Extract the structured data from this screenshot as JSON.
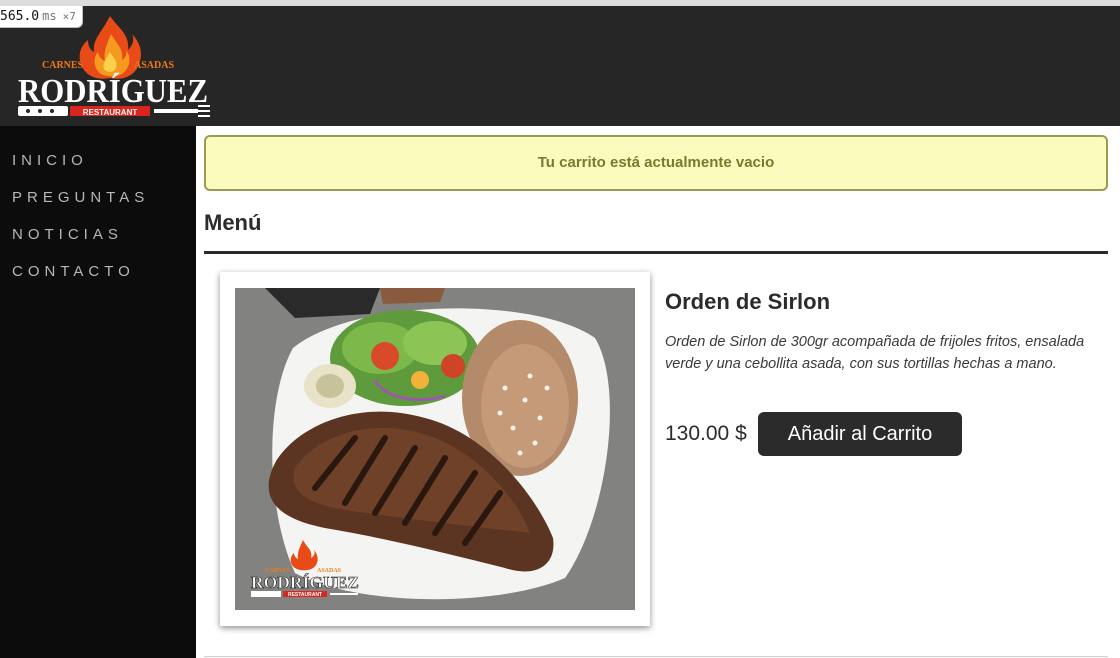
{
  "debug_overlay": {
    "time_value": "565.0",
    "time_unit": "ms",
    "multiplier": "×7"
  },
  "brand": {
    "line_left": "CARNES",
    "line_right": "ASADAS",
    "name": "RODRÍGUEZ",
    "sub": "RESTAURANT",
    "colors": {
      "orange": "#f07a1a",
      "red": "#d9251c",
      "white": "#ffffff"
    }
  },
  "nav": {
    "items": [
      {
        "label": "INICIO"
      },
      {
        "label": "PREGUNTAS"
      },
      {
        "label": "NOTICIAS"
      },
      {
        "label": "CONTACTO"
      }
    ]
  },
  "cart_alert": {
    "text": "Tu carrito está actualmente vacio"
  },
  "menu": {
    "title": "Menú",
    "items": [
      {
        "name": "Orden de Sirlon",
        "description": "Orden de Sirlon de 300gr acompañada de frijoles fritos, ensalada verde y una cebollita asada, con sus tortillas hechas a mano.",
        "price": "130.00 $",
        "add_button_label": "Añadir al Carrito",
        "photo_watermark": {
          "line_left": "CARNES",
          "line_right": "ASADAS",
          "name": "RODRÍGUEZ",
          "sub": "RESTAURANT"
        }
      }
    ]
  },
  "colors": {
    "header_bg": "#262626",
    "sidebar_bg": "#0c0c0c",
    "alert_bg": "#fbfbbd",
    "alert_text": "#7a7a2c",
    "button_bg": "#2b2b2b"
  }
}
